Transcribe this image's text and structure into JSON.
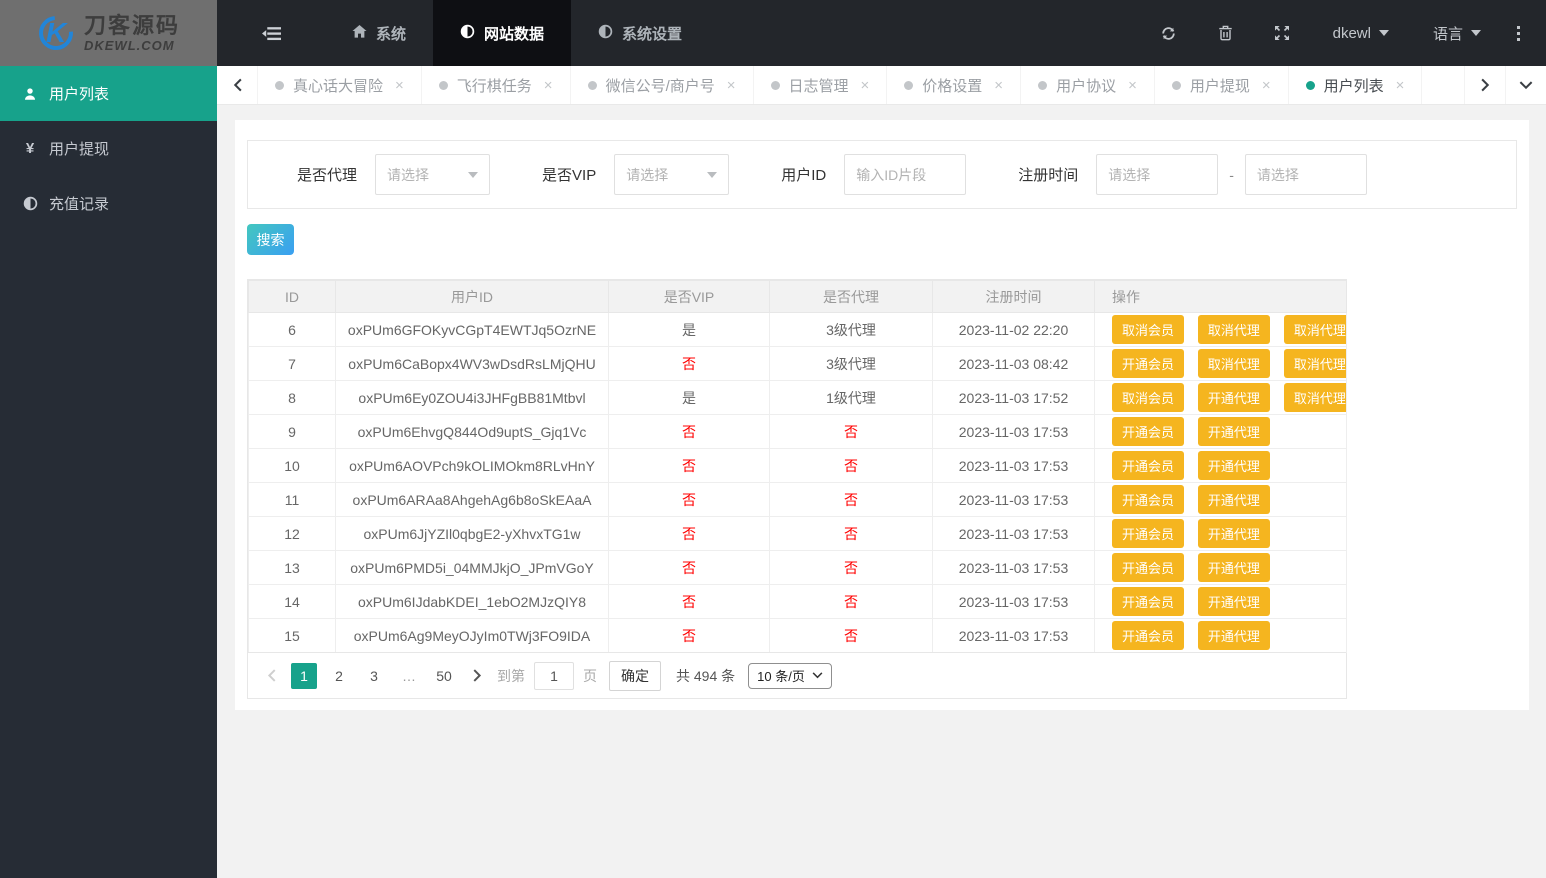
{
  "topbar": {
    "logo_line1": "刀客源码",
    "logo_line2": "DKEWL.COM",
    "logo_letter": "K",
    "nav": [
      {
        "label": "系统"
      },
      {
        "label": "网站数据"
      },
      {
        "label": "系统设置"
      }
    ],
    "username": "dkewl",
    "language_label": "语言"
  },
  "sidebar": {
    "items": [
      {
        "label": "用户列表"
      },
      {
        "label": "用户提现"
      },
      {
        "label": "充值记录"
      }
    ],
    "yen_glyph": "¥"
  },
  "tabs": {
    "items": [
      {
        "label": "真心话大冒险"
      },
      {
        "label": "飞行棋任务"
      },
      {
        "label": "微信公号/商户号"
      },
      {
        "label": "日志管理"
      },
      {
        "label": "价格设置"
      },
      {
        "label": "用户协议"
      },
      {
        "label": "用户提现"
      },
      {
        "label": "用户列表"
      }
    ],
    "close_glyph": "×"
  },
  "filters": {
    "agent": {
      "label": "是否代理",
      "placeholder": "请选择"
    },
    "vip": {
      "label": "是否VIP",
      "placeholder": "请选择"
    },
    "user_id": {
      "label": "用户ID",
      "placeholder": "输入ID片段"
    },
    "reg_time": {
      "label": "注册时间",
      "start_placeholder": "请选择",
      "end_placeholder": "请选择",
      "separator": "-"
    }
  },
  "search_button": "搜索",
  "table": {
    "columns": [
      "ID",
      "用户ID",
      "是否VIP",
      "是否代理",
      "注册时间",
      "操作"
    ],
    "rows": [
      {
        "id": "6",
        "user_id": "oxPUm6GFOKyvCGpT4EWTJq5OzrNE",
        "vip": "是",
        "agent": "3级代理",
        "time": "2023-11-02 22:20",
        "actions": [
          "取消会员",
          "取消代理",
          "取消代理"
        ]
      },
      {
        "id": "7",
        "user_id": "oxPUm6CaBopx4WV3wDsdRsLMjQHU",
        "vip": "否",
        "agent": "3级代理",
        "time": "2023-11-03 08:42",
        "actions": [
          "开通会员",
          "取消代理",
          "取消代理"
        ]
      },
      {
        "id": "8",
        "user_id": "oxPUm6Ey0ZOU4i3JHFgBB81Mtbvl",
        "vip": "是",
        "agent": "1级代理",
        "time": "2023-11-03 17:52",
        "actions": [
          "取消会员",
          "开通代理",
          "取消代理"
        ]
      },
      {
        "id": "9",
        "user_id": "oxPUm6EhvgQ844Od9uptS_Gjq1Vc",
        "vip": "否",
        "agent": "否",
        "time": "2023-11-03 17:53",
        "actions": [
          "开通会员",
          "开通代理"
        ]
      },
      {
        "id": "10",
        "user_id": "oxPUm6AOVPch9kOLIMOkm8RLvHnY",
        "vip": "否",
        "agent": "否",
        "time": "2023-11-03 17:53",
        "actions": [
          "开通会员",
          "开通代理"
        ]
      },
      {
        "id": "11",
        "user_id": "oxPUm6ARAa8AhgehAg6b8oSkEAaA",
        "vip": "否",
        "agent": "否",
        "time": "2023-11-03 17:53",
        "actions": [
          "开通会员",
          "开通代理"
        ]
      },
      {
        "id": "12",
        "user_id": "oxPUm6JjYZIl0qbgE2-yXhvxTG1w",
        "vip": "否",
        "agent": "否",
        "time": "2023-11-03 17:53",
        "actions": [
          "开通会员",
          "开通代理"
        ]
      },
      {
        "id": "13",
        "user_id": "oxPUm6PMD5i_04MMJkjO_JPmVGoY",
        "vip": "否",
        "agent": "否",
        "time": "2023-11-03 17:53",
        "actions": [
          "开通会员",
          "开通代理"
        ]
      },
      {
        "id": "14",
        "user_id": "oxPUm6IJdabKDEI_1ebO2MJzQIY8",
        "vip": "否",
        "agent": "否",
        "time": "2023-11-03 17:53",
        "actions": [
          "开通会员",
          "开通代理"
        ]
      },
      {
        "id": "15",
        "user_id": "oxPUm6Ag9MeyOJyIm0TWj3FO9IDA",
        "vip": "否",
        "agent": "否",
        "time": "2023-11-03 17:53",
        "actions": [
          "开通会员",
          "开通代理"
        ]
      }
    ]
  },
  "pagination": {
    "pages": [
      "1",
      "2",
      "3",
      "…",
      "50"
    ],
    "active_page": "1",
    "goto_label": "到第",
    "goto_value": "1",
    "page_unit": "页",
    "confirm_label": "确定",
    "total_label": "共 494 条",
    "page_size": "10 条/页"
  },
  "colors": {
    "accent_teal": "#17a28b",
    "action_orange": "#f5b51f",
    "negative_red": "#ff0000",
    "search_gradient": [
      "#43c7bf",
      "#3a9ff2"
    ],
    "topbar_bg": "#23262b",
    "sidebar_bg": "#262c35"
  }
}
